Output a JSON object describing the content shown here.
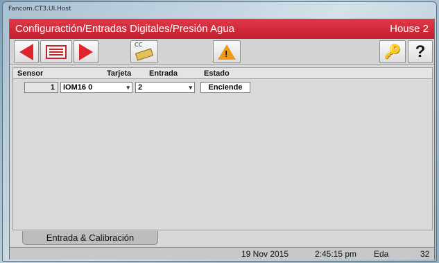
{
  "window": {
    "title": "Fancom.CT3.UI.Host"
  },
  "header": {
    "title": "Configuractión/Entradas Digitales/Presión Agua",
    "house": "House 2"
  },
  "toolbar": {
    "buttons": [
      {
        "icon": "arrow-left-icon"
      },
      {
        "icon": "list-icon"
      },
      {
        "icon": "arrow-right-icon"
      },
      {
        "icon": "card-icon",
        "label": "CC"
      },
      {
        "icon": "warning-icon",
        "label": "!"
      },
      {
        "icon": "key-icon"
      },
      {
        "icon": "help-icon",
        "label": "?"
      }
    ]
  },
  "table": {
    "columns": [
      "Sensor",
      "Tarjeta",
      "Entrada",
      "Estado"
    ],
    "rows": [
      {
        "sensor": "1",
        "tarjeta": "IOM16 0",
        "entrada": "2",
        "estado": "Enciende"
      }
    ]
  },
  "tabs": [
    {
      "label": "Entrada & Calibración",
      "active": true
    }
  ],
  "status": {
    "date": "19 Nov 2015",
    "time": "2:45:15 pm",
    "user": "Eda",
    "number": "32"
  },
  "colors": {
    "accent": "#d42a3a",
    "arrow": "#e0242c",
    "warning": "#f09a1a"
  }
}
